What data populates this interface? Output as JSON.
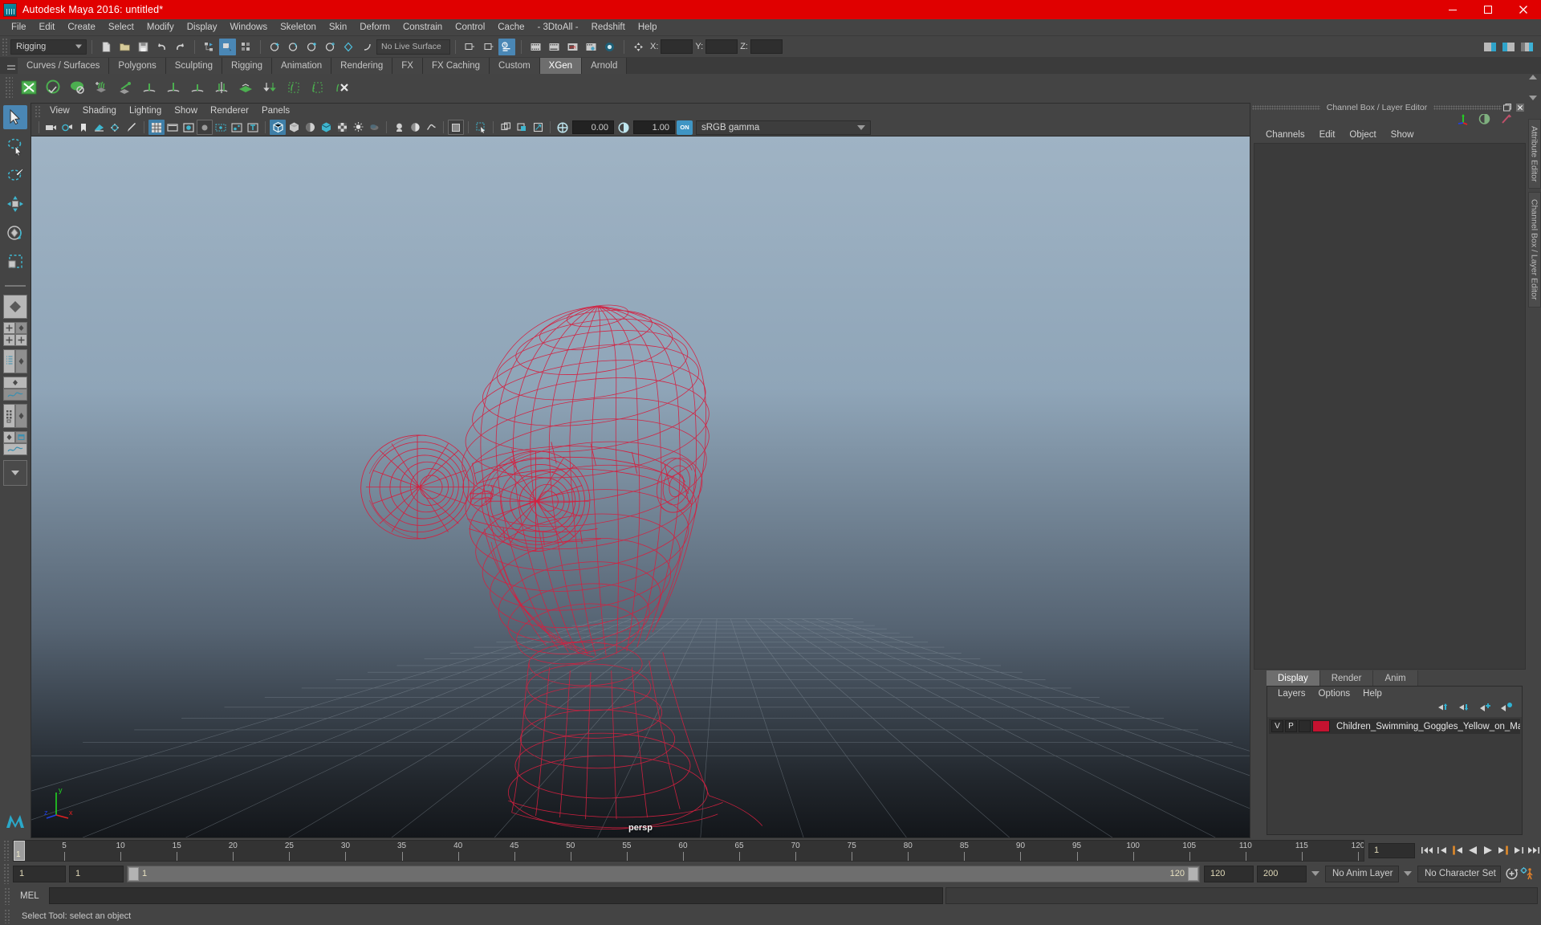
{
  "window": {
    "title": "Autodesk Maya 2016: untitled*",
    "app_icon": "maya-logo-icon",
    "minimize": "minimize-icon",
    "maximize": "maximize-icon",
    "close": "close-icon",
    "title_bar_color": "#e00000"
  },
  "menubar": {
    "items": [
      "File",
      "Edit",
      "Create",
      "Select",
      "Modify",
      "Display",
      "Windows",
      "Skeleton",
      "Skin",
      "Deform",
      "Constrain",
      "Control",
      "Cache",
      "- 3DtoAll -",
      "Redshift",
      "Help"
    ]
  },
  "statusbar": {
    "menu_set": "Rigging",
    "live_surface": "No Live Surface",
    "axis_labels": [
      "X:",
      "Y:",
      "Z:"
    ],
    "axis_values": [
      "",
      "",
      ""
    ]
  },
  "shelf": {
    "tabs": [
      "Curves / Surfaces",
      "Polygons",
      "Sculpting",
      "Rigging",
      "Animation",
      "Rendering",
      "FX",
      "FX Caching",
      "Custom",
      "XGen",
      "Arnold"
    ],
    "active_tab": "XGen"
  },
  "viewport": {
    "menu": [
      "View",
      "Shading",
      "Lighting",
      "Show",
      "Renderer",
      "Panels"
    ],
    "exposure_value": "0.00",
    "gamma_value": "1.00",
    "color_management_toggle": "ON",
    "color_profile": "sRGB gamma",
    "camera_label": "persp",
    "axis_gizmo": {
      "x": "x",
      "y": "y",
      "z": "z"
    },
    "wireframe_color": "#d42040",
    "background_top": "#9fb3c4",
    "background_bottom": "#14171a"
  },
  "channel_box": {
    "panel_title": "Channel Box / Layer Editor",
    "menu": [
      "Channels",
      "Edit",
      "Object",
      "Show"
    ]
  },
  "layer_editor": {
    "tabs": [
      "Display",
      "Render",
      "Anim"
    ],
    "active_tab": "Display",
    "menu": [
      "Layers",
      "Options",
      "Help"
    ],
    "layers": [
      {
        "visibility": "V",
        "playback": "P",
        "shading": "",
        "color": "#c41230",
        "name": "Children_Swimming_Goggles_Yellow_on_Mannequin_mt"
      }
    ]
  },
  "side_tabs": [
    "Attribute Editor",
    "Channel Box / Layer Editor"
  ],
  "timeline": {
    "ticks": [
      5,
      10,
      15,
      20,
      25,
      30,
      35,
      40,
      45,
      50,
      55,
      60,
      65,
      70,
      75,
      80,
      85,
      90,
      95,
      100,
      105,
      110,
      115,
      120
    ],
    "start": 1,
    "end": 120,
    "current_frame": "1",
    "current_frame_field": "1",
    "playback_buttons": [
      "go-to-start-icon",
      "step-back-key-icon",
      "step-back-frame-icon",
      "play-backwards-icon",
      "play-forwards-icon",
      "step-forward-frame-icon",
      "step-forward-key-icon",
      "go-to-end-icon"
    ]
  },
  "range_slider": {
    "anim_start": "1",
    "range_start": "1",
    "bar_start_label": "1",
    "bar_end_label": "120",
    "range_end": "120",
    "anim_end": "200",
    "anim_layer": "No Anim Layer",
    "character_set": "No Character Set",
    "auto_key_icon": "auto-keyframe-icon",
    "anim_prefs_icon": "animation-preferences-icon"
  },
  "command_line": {
    "language": "MEL",
    "input_value": "",
    "output_value": ""
  },
  "help_line": {
    "text": "Select Tool: select an object"
  },
  "toolbox": {
    "tools": [
      "select-tool",
      "lasso-select-tool",
      "paint-select-tool",
      "move-tool",
      "rotate-tool",
      "scale-tool"
    ],
    "active_tool": "select-tool",
    "layouts": [
      "single-perspective-layout",
      "four-view-layout",
      "outliner-persp-layout",
      "persp-graph-layout",
      "hypershade-persp-layout",
      "persp-render-layout"
    ]
  }
}
